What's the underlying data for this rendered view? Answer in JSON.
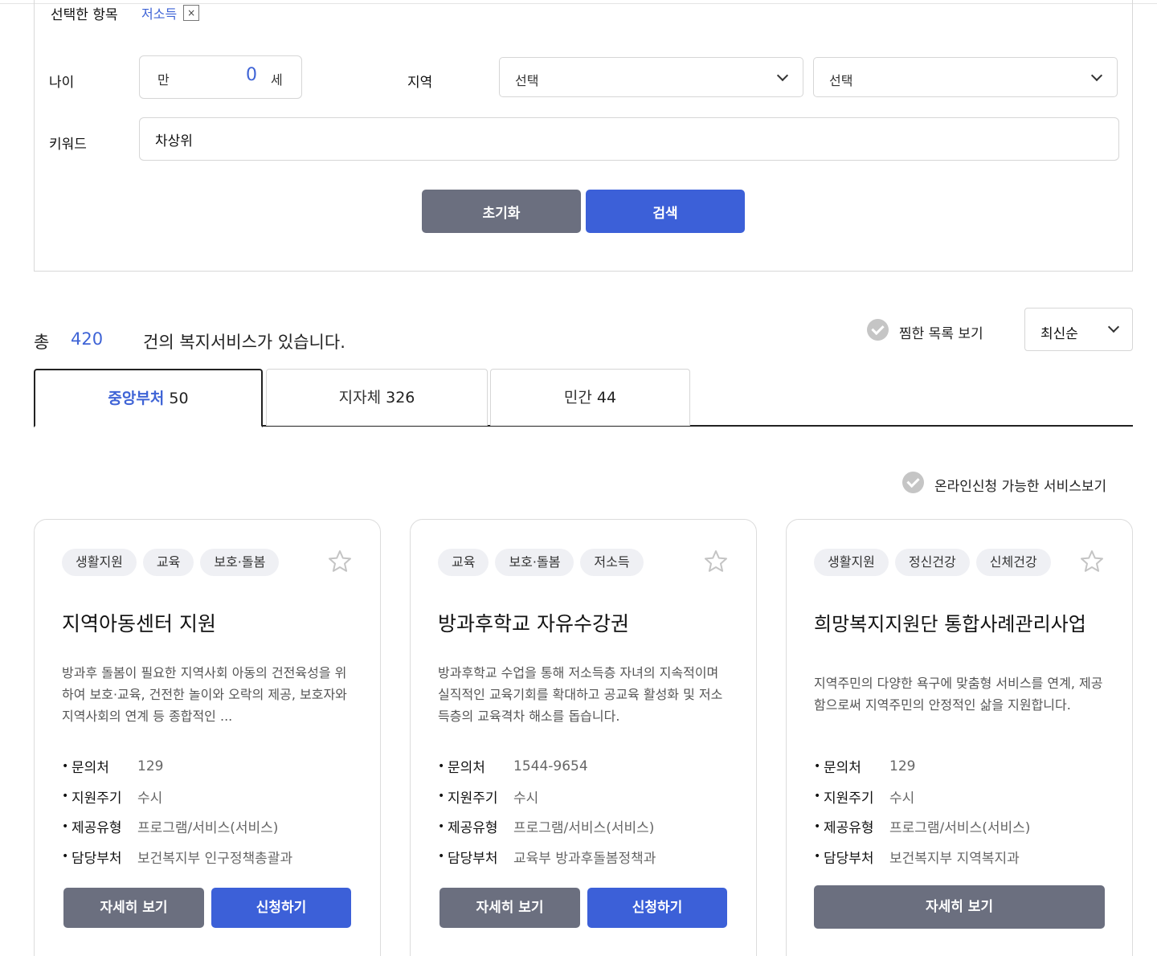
{
  "filters": {
    "selected_label": "선택한 항목",
    "selected_chip": "저소득",
    "selected_chip_remove": "×",
    "age_label": "나이",
    "age_prefix": "만",
    "age_value": "0",
    "age_suffix": "세",
    "region_label": "지역",
    "region_select_1": "선택",
    "region_select_2": "선택",
    "keyword_label": "키워드",
    "keyword_value": "차상위",
    "reset_button": "초기화",
    "search_button": "검색"
  },
  "summary": {
    "prefix": "총",
    "count": "420",
    "suffix": "건의 복지서비스가 있습니다.",
    "favorites_toggle": "찜한 목록 보기",
    "sort_value": "최신순",
    "online_toggle": "온라인신청 가능한 서비스보기"
  },
  "tabs": [
    {
      "label": "중앙부처",
      "count": "50"
    },
    {
      "label": "지자체",
      "count": "326"
    },
    {
      "label": "민간",
      "count": "44"
    }
  ],
  "info_labels": {
    "contact": "문의처",
    "cycle": "지원주기",
    "type": "제공유형",
    "dept": "담당부처"
  },
  "cards": [
    {
      "tags": [
        "생활지원",
        "교육",
        "보호·돌봄"
      ],
      "title": "지역아동센터 지원",
      "desc": "방과후 돌봄이 필요한 지역사회 아동의 건전육성을 위하여 보호·교육, 건전한 놀이와 오락의 제공, 보호자와 지역사회의 연계 등 종합적인  ...",
      "contact": "129",
      "cycle": "수시",
      "type": "프로그램/서비스(서비스)",
      "dept": "보건복지부 인구정책총괄과",
      "detail_button": "자세히 보기",
      "apply_button": "신청하기"
    },
    {
      "tags": [
        "교육",
        "보호·돌봄",
        "저소득"
      ],
      "title": "방과후학교 자유수강권",
      "desc": "방과후학교 수업을 통해 저소득층 자녀의 지속적이며 실직적인 교육기회를 확대하고 공교육 활성화 및 저소득층의 교육격차 해소를 돕습니다.",
      "contact": "1544-9654",
      "cycle": "수시",
      "type": "프로그램/서비스(서비스)",
      "dept": "교육부 방과후돌봄정책과",
      "detail_button": "자세히 보기",
      "apply_button": "신청하기"
    },
    {
      "tags": [
        "생활지원",
        "정신건강",
        "신체건강"
      ],
      "title": "희망복지지원단 통합사례관리사업",
      "desc": "지역주민의 다양한 욕구에 맞춤형 서비스를 연계, 제공함으로써 지역주민의 안정적인 삶을 지원합니다.",
      "contact": "129",
      "cycle": "수시",
      "type": "프로그램/서비스(서비스)",
      "dept": "보건복지부 지역복지과",
      "detail_button": "자세히 보기"
    }
  ],
  "colors": {
    "accent": "#3c60d8",
    "gray_button": "#6b6f7f",
    "tag_bg": "#eff0f4"
  }
}
